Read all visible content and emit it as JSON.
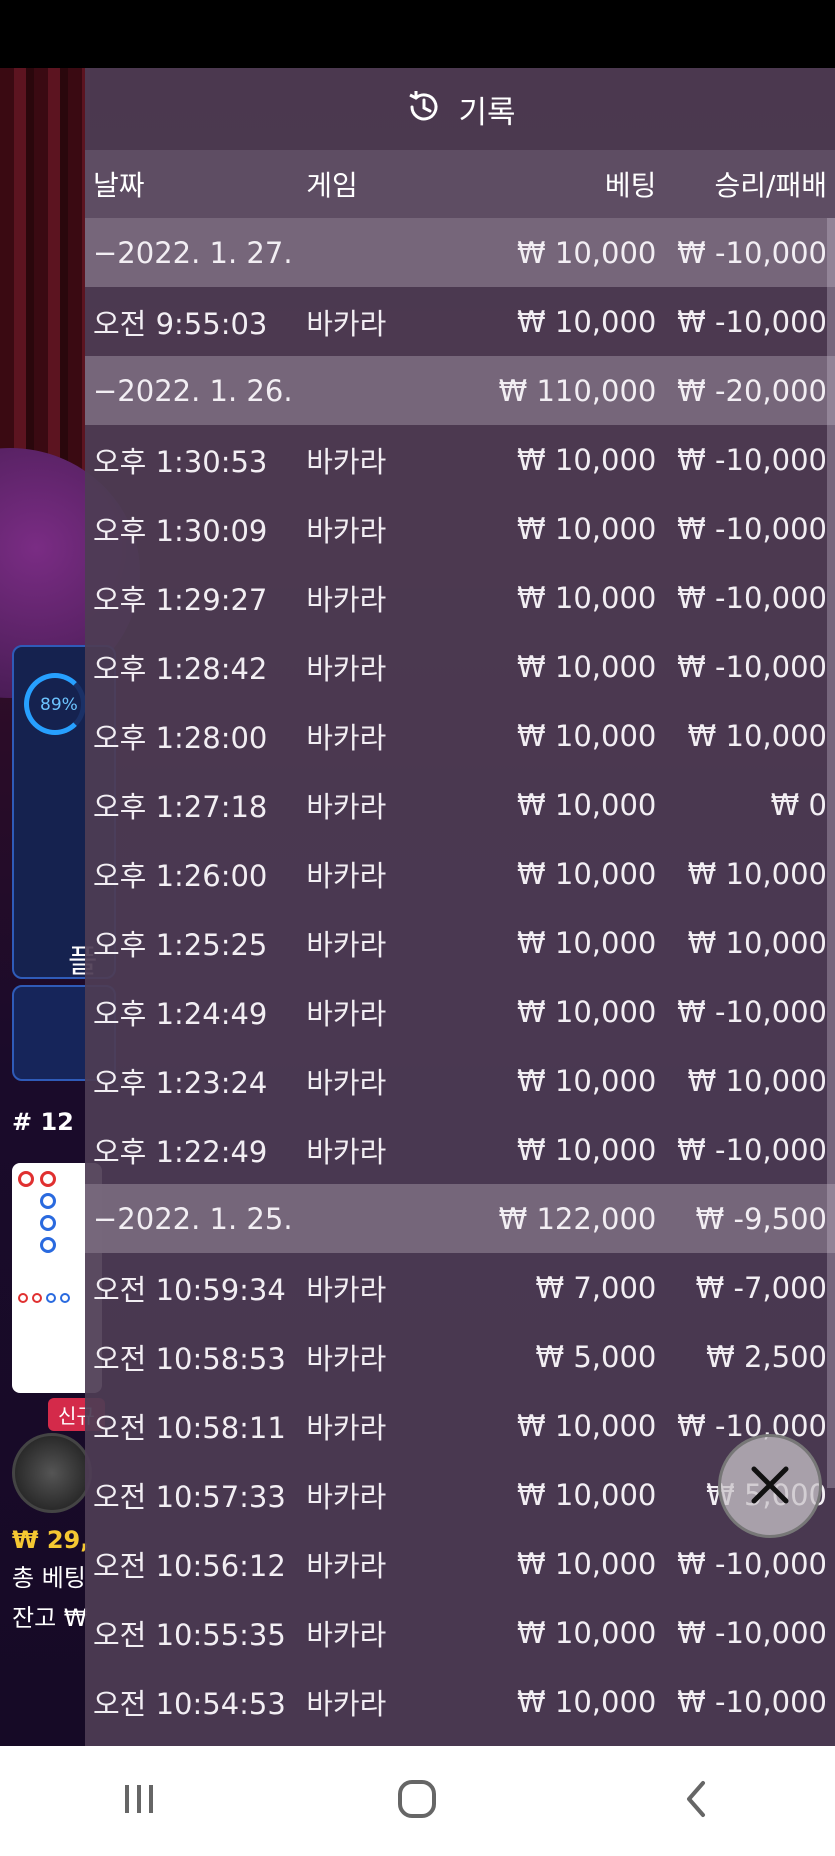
{
  "background": {
    "ring_percent": "89%",
    "panel_text": "플",
    "round_label": "# 12",
    "new_badge": "신규",
    "amount_partial": "₩ 29,",
    "total_bet_label": "총 베팅",
    "balance_label": "잔고 ₩"
  },
  "history": {
    "title": "기록",
    "columns": {
      "date": "날짜",
      "game": "게임",
      "bet": "베팅",
      "winloss": "승리/패배"
    },
    "rows": [
      {
        "type": "date",
        "time": "−2022. 1. 27.",
        "game": "",
        "bet": "₩ 10,000",
        "result": "₩ -10,000"
      },
      {
        "type": "entry",
        "time": "오전 9:55:03",
        "game": "바카라",
        "bet": "₩ 10,000",
        "result": "₩ -10,000"
      },
      {
        "type": "date",
        "time": "−2022. 1. 26.",
        "game": "",
        "bet": "₩ 110,000",
        "result": "₩ -20,000"
      },
      {
        "type": "entry",
        "time": "오후 1:30:53",
        "game": "바카라",
        "bet": "₩ 10,000",
        "result": "₩ -10,000"
      },
      {
        "type": "entry",
        "time": "오후 1:30:09",
        "game": "바카라",
        "bet": "₩ 10,000",
        "result": "₩ -10,000"
      },
      {
        "type": "entry",
        "time": "오후 1:29:27",
        "game": "바카라",
        "bet": "₩ 10,000",
        "result": "₩ -10,000"
      },
      {
        "type": "entry",
        "time": "오후 1:28:42",
        "game": "바카라",
        "bet": "₩ 10,000",
        "result": "₩ -10,000"
      },
      {
        "type": "entry",
        "time": "오후 1:28:00",
        "game": "바카라",
        "bet": "₩ 10,000",
        "result": "₩ 10,000"
      },
      {
        "type": "entry",
        "time": "오후 1:27:18",
        "game": "바카라",
        "bet": "₩ 10,000",
        "result": "₩ 0"
      },
      {
        "type": "entry",
        "time": "오후 1:26:00",
        "game": "바카라",
        "bet": "₩ 10,000",
        "result": "₩ 10,000"
      },
      {
        "type": "entry",
        "time": "오후 1:25:25",
        "game": "바카라",
        "bet": "₩ 10,000",
        "result": "₩ 10,000"
      },
      {
        "type": "entry",
        "time": "오후 1:24:49",
        "game": "바카라",
        "bet": "₩ 10,000",
        "result": "₩ -10,000"
      },
      {
        "type": "entry",
        "time": "오후 1:23:24",
        "game": "바카라",
        "bet": "₩ 10,000",
        "result": "₩ 10,000"
      },
      {
        "type": "entry",
        "time": "오후 1:22:49",
        "game": "바카라",
        "bet": "₩ 10,000",
        "result": "₩ -10,000"
      },
      {
        "type": "date",
        "time": "−2022. 1. 25.",
        "game": "",
        "bet": "₩ 122,000",
        "result": "₩ -9,500"
      },
      {
        "type": "entry",
        "time": "오전 10:59:34",
        "game": "바카라",
        "bet": "₩ 7,000",
        "result": "₩ -7,000"
      },
      {
        "type": "entry",
        "time": "오전 10:58:53",
        "game": "바카라",
        "bet": "₩ 5,000",
        "result": "₩ 2,500"
      },
      {
        "type": "entry",
        "time": "오전 10:58:11",
        "game": "바카라",
        "bet": "₩ 10,000",
        "result": "₩ -10,000"
      },
      {
        "type": "entry",
        "time": "오전 10:57:33",
        "game": "바카라",
        "bet": "₩ 10,000",
        "result": "₩ 5,000"
      },
      {
        "type": "entry",
        "time": "오전 10:56:12",
        "game": "바카라",
        "bet": "₩ 10,000",
        "result": "₩ -10,000"
      },
      {
        "type": "entry",
        "time": "오전 10:55:35",
        "game": "바카라",
        "bet": "₩ 10,000",
        "result": "₩ -10,000"
      },
      {
        "type": "entry",
        "time": "오전 10:54:53",
        "game": "바카라",
        "bet": "₩ 10,000",
        "result": "₩ -10,000"
      }
    ]
  },
  "icons": {
    "history": "history-clock-icon",
    "close": "close-x-icon",
    "recents": "recents-icon",
    "home": "home-icon",
    "back": "back-icon"
  }
}
